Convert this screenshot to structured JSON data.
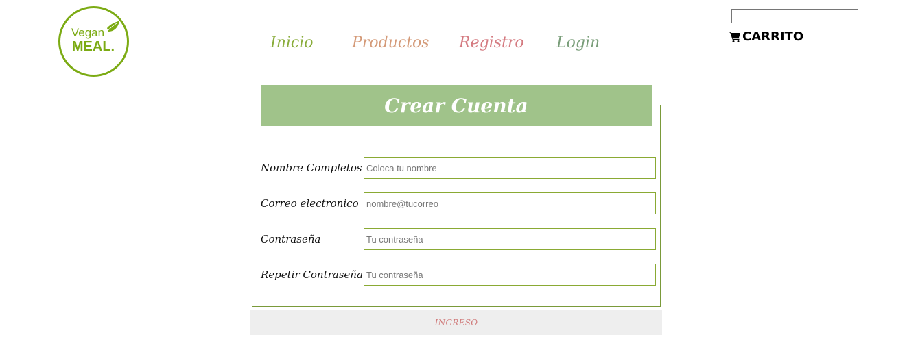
{
  "brand": {
    "line1": "Vegan",
    "line2": "MEAL.",
    "color": "#7cab14"
  },
  "nav": [
    {
      "label": "Inicio",
      "color": "#8aad3c"
    },
    {
      "label": "Productos",
      "color": "#d49a78"
    },
    {
      "label": "Registro",
      "color": "#d47a80"
    },
    {
      "label": "Login",
      "color": "#7a9e7a"
    }
  ],
  "header": {
    "search": {
      "value": "",
      "placeholder": ""
    },
    "cart_label": "CARRITO",
    "cart_icon": "shopping-cart-icon"
  },
  "form": {
    "title": "Crear Cuenta",
    "header_color": "#a0c38a",
    "fields": [
      {
        "label": "Nombre Completos",
        "placeholder": "Coloca tu nombre",
        "value": ""
      },
      {
        "label": "Correo electronico",
        "placeholder": "nombre@tucorreo",
        "value": ""
      },
      {
        "label": "Contraseña",
        "placeholder": "Tu contraseña",
        "value": ""
      },
      {
        "label": "Repetir Contraseña",
        "placeholder": "Tu contraseña",
        "value": ""
      }
    ],
    "submit_label": "INGRESO"
  }
}
